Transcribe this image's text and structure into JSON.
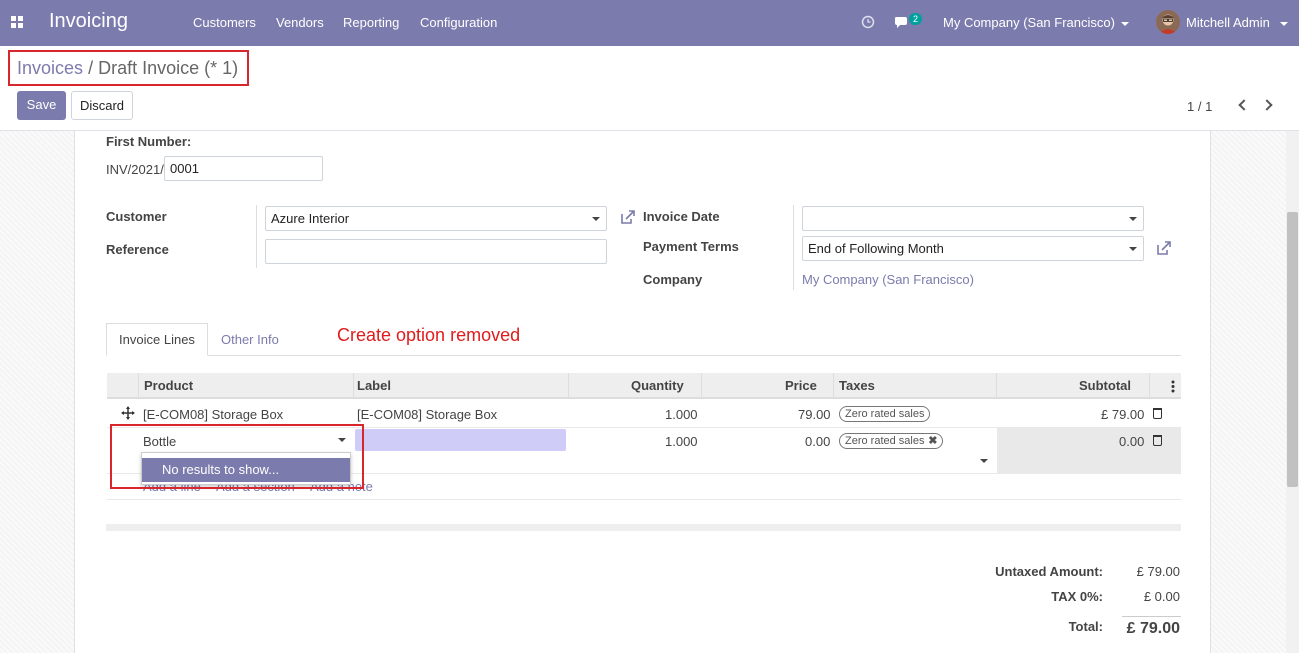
{
  "navbar": {
    "app_name": "Invoicing",
    "menu": [
      "Customers",
      "Vendors",
      "Reporting",
      "Configuration"
    ],
    "messages_count": "2",
    "company": "My Company (San Francisco)",
    "user": "Mitchell Admin"
  },
  "breadcrumb": {
    "parent": "Invoices",
    "separator": "/",
    "current": "Draft Invoice (* 1)"
  },
  "actions": {
    "save": "Save",
    "discard": "Discard"
  },
  "pager": {
    "text": "1 / 1"
  },
  "form": {
    "first_number_label": "First Number:",
    "number_prefix": "INV/2021/",
    "number_value": "0001",
    "customer_label": "Customer",
    "customer_value": "Azure Interior",
    "reference_label": "Reference",
    "reference_value": "",
    "invoice_date_label": "Invoice Date",
    "invoice_date_value": "",
    "payment_terms_label": "Payment Terms",
    "payment_terms_value": "End of Following Month",
    "company_label": "Company",
    "company_value": "My Company (San Francisco)"
  },
  "tabs": [
    {
      "label": "Invoice Lines",
      "active": true
    },
    {
      "label": "Other Info",
      "active": false
    }
  ],
  "annotation": "Create option removed",
  "table": {
    "headers": [
      "Product",
      "Label",
      "Quantity",
      "Price",
      "Taxes",
      "Subtotal"
    ],
    "rows": [
      {
        "product": "[E-COM08] Storage Box",
        "label": "[E-COM08] Storage Box",
        "quantity": "1.000",
        "price": "79.00",
        "tax": "Zero rated sales",
        "subtotal": "£ 79.00"
      },
      {
        "product": "Bottle",
        "label": "",
        "quantity": "1.000",
        "price": "0.00",
        "tax": "Zero rated sales",
        "subtotal": "0.00"
      }
    ],
    "dropdown_item": "No results to show...",
    "add_links": [
      "Add a line",
      "Add a section",
      "Add a note"
    ]
  },
  "totals": {
    "untaxed_label": "Untaxed Amount:",
    "untaxed_value": "£ 79.00",
    "tax_label": "TAX 0%:",
    "tax_value": "£ 0.00",
    "total_label": "Total:",
    "total_value": "£ 79.00"
  },
  "colors": {
    "brand": "#7c7bad",
    "annotation": "#d9262c"
  }
}
